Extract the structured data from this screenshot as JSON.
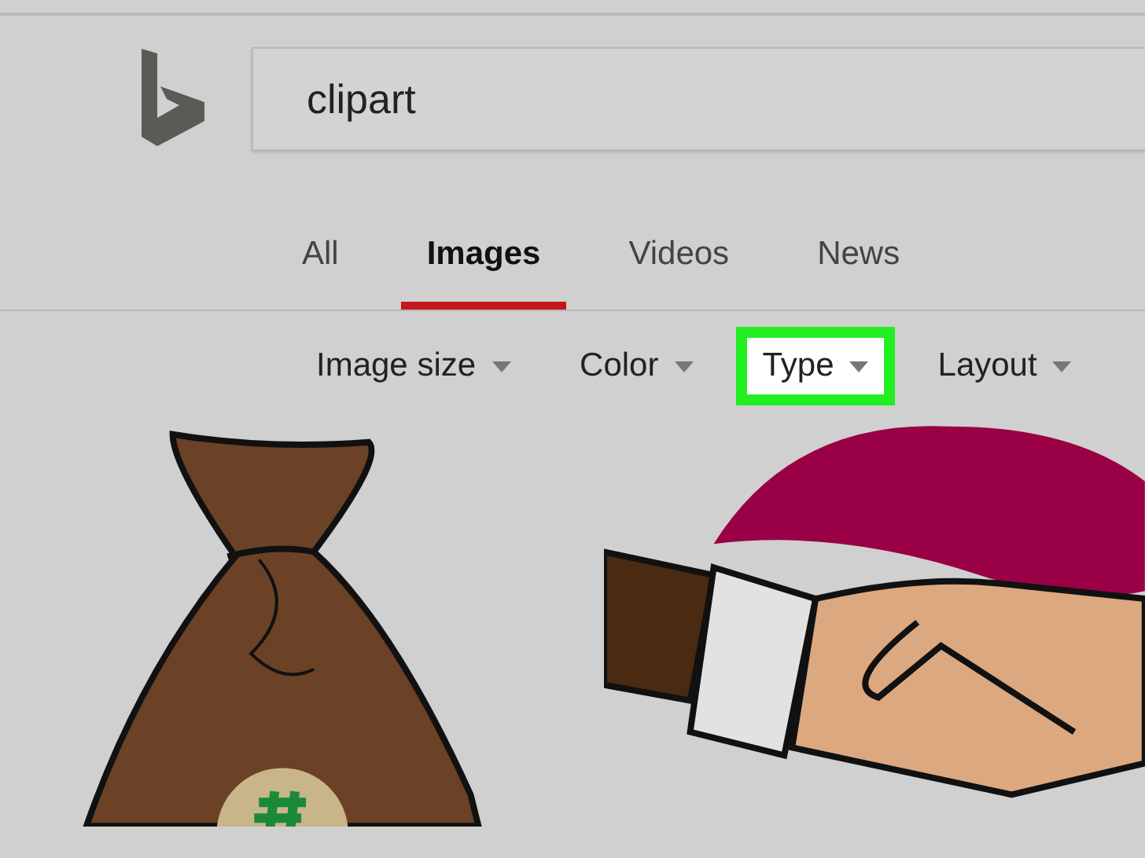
{
  "search": {
    "value": "clipart"
  },
  "tabs": [
    {
      "label": "All",
      "selected": false
    },
    {
      "label": "Images",
      "selected": true
    },
    {
      "label": "Videos",
      "selected": false
    },
    {
      "label": "News",
      "selected": false
    }
  ],
  "filters": [
    {
      "label": "Image size",
      "highlighted": false
    },
    {
      "label": "Color",
      "highlighted": false
    },
    {
      "label": "Type",
      "highlighted": true
    },
    {
      "label": "Layout",
      "highlighted": false
    }
  ]
}
